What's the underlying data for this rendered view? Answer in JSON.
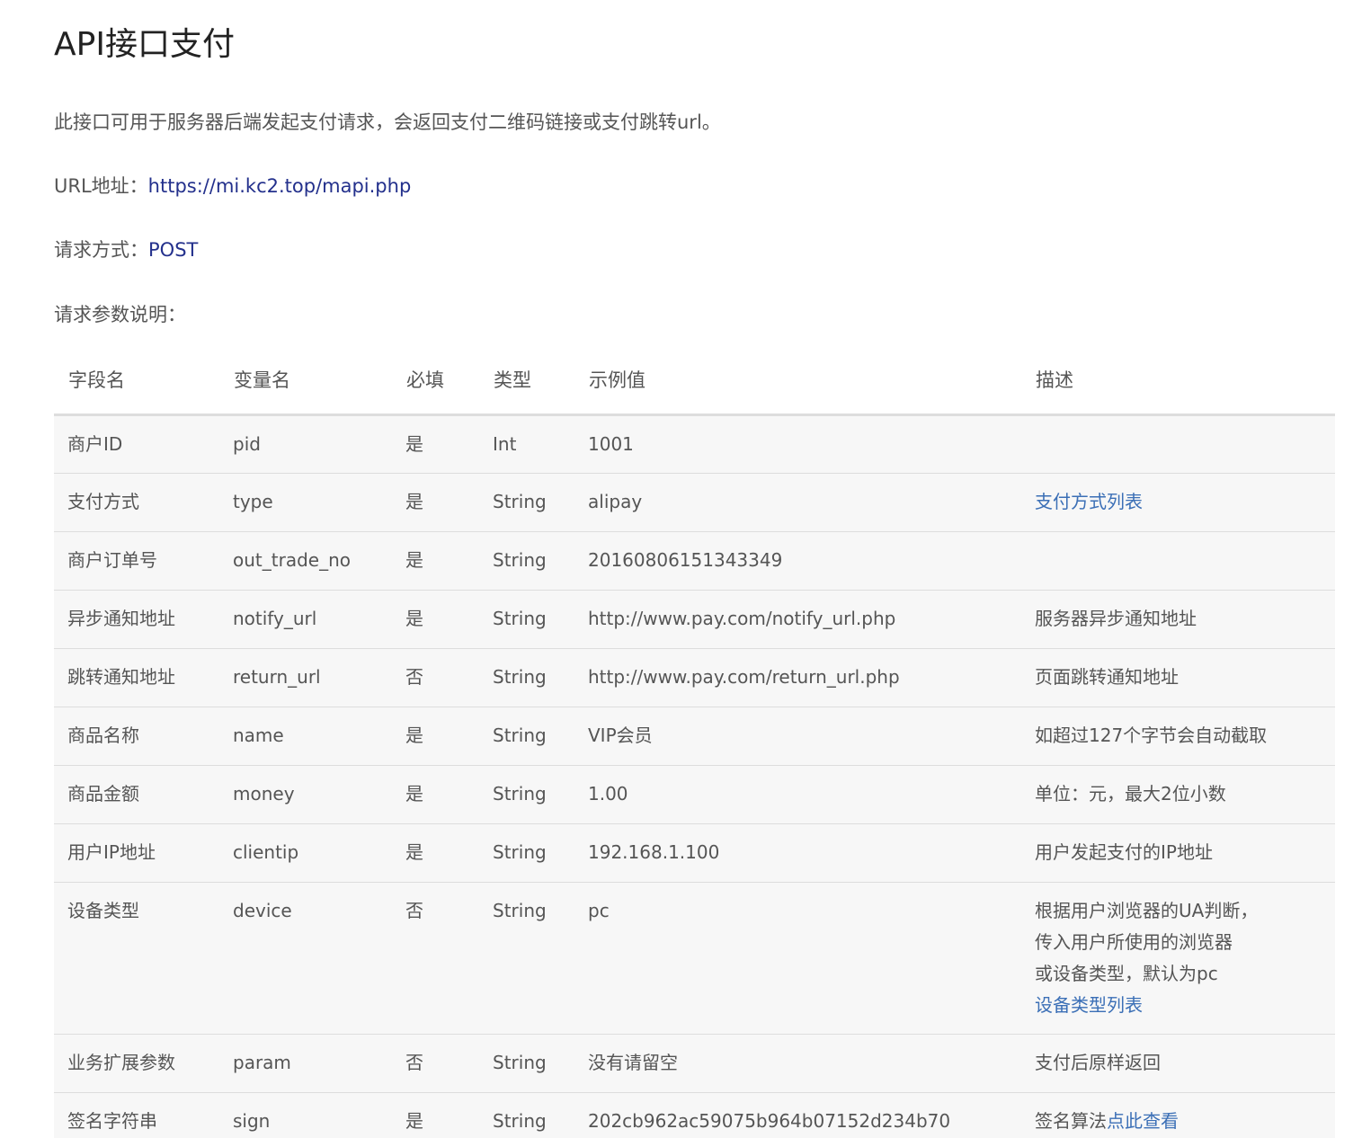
{
  "title": "API接口支付",
  "description": "此接口可用于服务器后端发起支付请求，会返回支付二维码链接或支付跳转url。",
  "url": {
    "label": "URL地址：",
    "value": "https://mi.kc2.top/mapi.php"
  },
  "method": {
    "label": "请求方式：",
    "value": "POST"
  },
  "params_heading": "请求参数说明：",
  "table": {
    "headers": [
      "字段名",
      "变量名",
      "必填",
      "类型",
      "示例值",
      "描述"
    ],
    "rows": [
      {
        "field": "商户ID",
        "var": "pid",
        "required": "是",
        "type": "Int",
        "example": "1001",
        "desc": ""
      },
      {
        "field": "支付方式",
        "var": "type",
        "required": "是",
        "type": "String",
        "example": "alipay",
        "desc": "",
        "desc_link": "支付方式列表"
      },
      {
        "field": "商户订单号",
        "var": "out_trade_no",
        "required": "是",
        "type": "String",
        "example": "20160806151343349",
        "desc": ""
      },
      {
        "field": "异步通知地址",
        "var": "notify_url",
        "required": "是",
        "type": "String",
        "example": "http://www.pay.com/notify_url.php",
        "desc": "服务器异步通知地址"
      },
      {
        "field": "跳转通知地址",
        "var": "return_url",
        "required": "否",
        "type": "String",
        "example": "http://www.pay.com/return_url.php",
        "desc": "页面跳转通知地址"
      },
      {
        "field": "商品名称",
        "var": "name",
        "required": "是",
        "type": "String",
        "example": "VIP会员",
        "desc": "如超过127个字节会自动截取"
      },
      {
        "field": "商品金额",
        "var": "money",
        "required": "是",
        "type": "String",
        "example": "1.00",
        "desc": "单位：元，最大2位小数"
      },
      {
        "field": "用户IP地址",
        "var": "clientip",
        "required": "是",
        "type": "String",
        "example": "192.168.1.100",
        "desc": "用户发起支付的IP地址"
      },
      {
        "field": "设备类型",
        "var": "device",
        "required": "否",
        "type": "String",
        "example": "pc",
        "desc_lines": [
          "根据用户浏览器的UA判断，",
          "传入用户所使用的浏览器",
          "或设备类型，默认为pc"
        ],
        "desc_link": "设备类型列表"
      },
      {
        "field": "业务扩展参数",
        "var": "param",
        "required": "否",
        "type": "String",
        "example": "没有请留空",
        "desc": "支付后原样返回"
      },
      {
        "field": "签名字符串",
        "var": "sign",
        "required": "是",
        "type": "String",
        "example": "202cb962ac59075b964b07152d234b70",
        "desc": "签名算法",
        "desc_link": "点此查看"
      }
    ]
  }
}
